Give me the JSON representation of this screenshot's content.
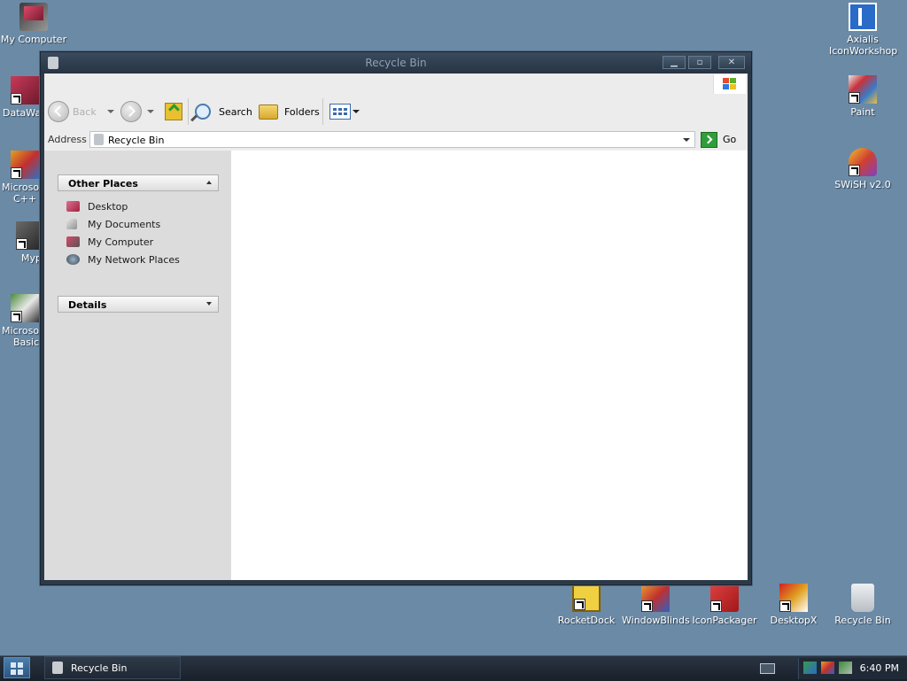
{
  "desktop": {
    "icons_left": [
      {
        "label": "My Computer",
        "icon": "my-computer-icon"
      },
      {
        "label": "DataWa",
        "icon": "datawa-shortcut-icon"
      },
      {
        "label": "Microsoft C++",
        "line1": "Microsoft",
        "line2": "C++",
        "icon": "visual-cpp-shortcut-icon"
      },
      {
        "label": "Myp",
        "icon": "myp-shortcut-icon"
      },
      {
        "label": "Microsoft Basic",
        "line1": "Microsoft",
        "line2": "Basic",
        "icon": "visual-basic-shortcut-icon"
      }
    ],
    "icons_right": [
      {
        "label": "Axialis IconWorkshop",
        "line1": "Axialis",
        "line2": "IconWorkshop",
        "icon": "axialis-icon"
      },
      {
        "label": "Paint",
        "icon": "paint-icon"
      },
      {
        "label": "SWiSH v2.0",
        "icon": "swish-icon"
      }
    ],
    "icons_bottom": [
      {
        "label": "RocketDock",
        "icon": "rocketdock-icon"
      },
      {
        "label": "WindowBlinds",
        "icon": "windowblinds-icon"
      },
      {
        "label": "IconPackager",
        "icon": "iconpackager-icon"
      },
      {
        "label": "DesktopX",
        "icon": "desktopx-icon"
      },
      {
        "label": "Recycle Bin",
        "icon": "recycle-bin-icon"
      }
    ]
  },
  "window": {
    "title": "Recycle Bin",
    "buttons": {
      "minimize": "minimize",
      "maximize": "maximize",
      "close": "close"
    },
    "toolbar": {
      "back_label": "Back",
      "search_label": "Search",
      "folders_label": "Folders"
    },
    "address": {
      "label": "Address",
      "value": "Recycle Bin",
      "go_label": "Go"
    },
    "sidebar": {
      "other_places": {
        "title": "Other Places",
        "items": [
          {
            "label": "Desktop",
            "icon": "desktop-icon",
            "color": "#b8324e"
          },
          {
            "label": "My Documents",
            "icon": "my-documents-icon",
            "color": "#b0b0b0"
          },
          {
            "label": "My Computer",
            "icon": "my-computer-icon",
            "color": "#c23c58"
          },
          {
            "label": "My Network Places",
            "icon": "network-places-icon",
            "color": "#6a6a6a"
          }
        ]
      },
      "details": {
        "title": "Details"
      }
    }
  },
  "taskbar": {
    "task_label": "Recycle Bin",
    "clock": "6:40 PM"
  },
  "colors": {
    "desktop": "#6b8aa6",
    "window_frame": "#2c3a48",
    "go_green": "#2f9e3a"
  }
}
